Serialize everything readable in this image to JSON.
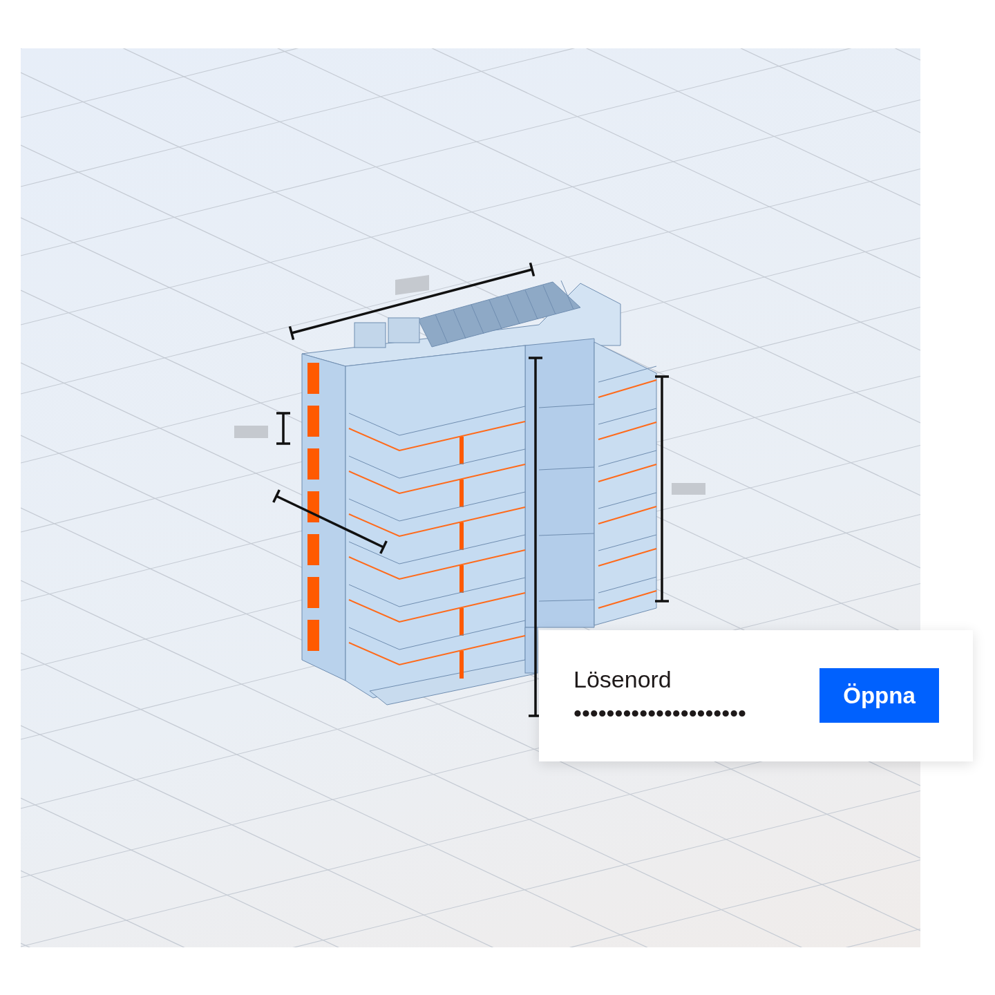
{
  "dialog": {
    "label": "Lösenord",
    "password": "•••••••••••••••••••••",
    "button": "Öppna"
  }
}
